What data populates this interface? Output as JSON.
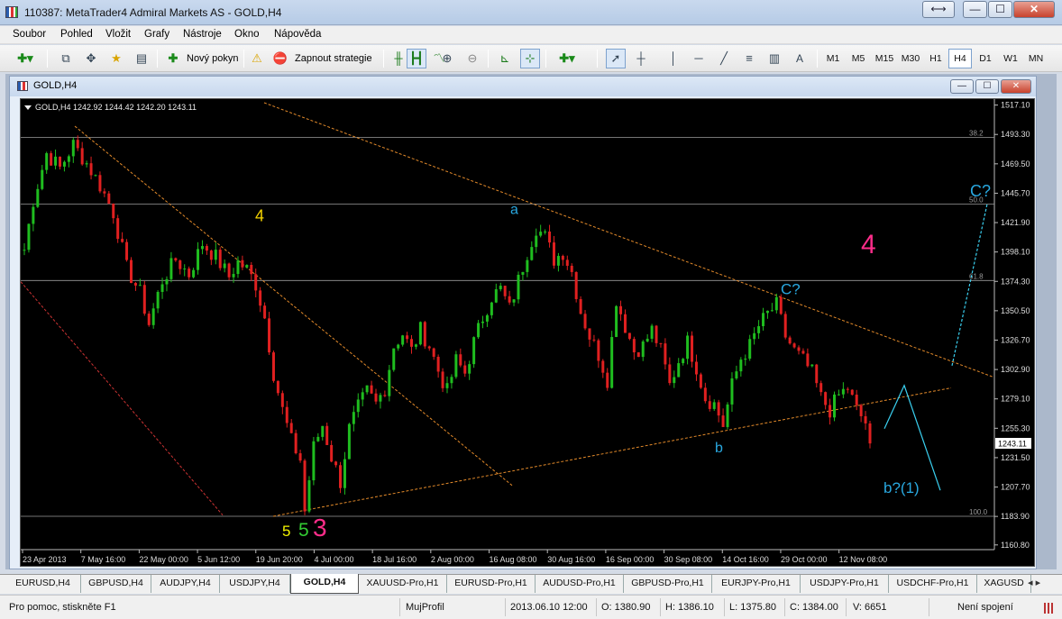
{
  "app": {
    "title": "110387: MetaTrader4 Admiral Markets AS - GOLD,H4"
  },
  "window_buttons": {
    "switch": "⟷",
    "minimize": "—",
    "maximize": "☐",
    "close": "✕"
  },
  "menu": [
    "Soubor",
    "Pohled",
    "Vložit",
    "Grafy",
    "Nástroje",
    "Okno",
    "Nápověda"
  ],
  "toolbar": {
    "new_order": "Nový pokyn",
    "auto_trading": "Zapnout strategie",
    "timeframes": [
      "M1",
      "M5",
      "M15",
      "M30",
      "H1",
      "H4",
      "D1",
      "W1",
      "MN"
    ],
    "active_timeframe": "H4",
    "text_tool": "A"
  },
  "chart_window": {
    "title": "GOLD,H4",
    "header": "GOLD,H4  1242.92 1244.42 1242.20 1243.11"
  },
  "chart_data": {
    "type": "candlestick",
    "symbol": "GOLD",
    "timeframe": "H4",
    "ohlc_last": {
      "open": 1242.92,
      "high": 1244.42,
      "low": 1242.2,
      "close": 1243.11
    },
    "current_price_label": "1243.11",
    "price_ticks": [
      1517.1,
      1493.3,
      1469.5,
      1445.7,
      1421.9,
      1398.1,
      1374.3,
      1350.5,
      1326.7,
      1302.9,
      1279.1,
      1255.3,
      1231.5,
      1207.7,
      1183.9,
      1160.8
    ],
    "price_tick_labels": [
      "1517.10",
      "1493.30",
      "1469.50",
      "1445.70",
      "1421.90",
      "1398.10",
      "1374.30",
      "1350.50",
      "1326.70",
      "1302.90",
      "1279.10",
      "1255.30",
      "1231.50",
      "1207.70",
      "1183.90",
      "1160.80"
    ],
    "ylim": [
      1157,
      1519
    ],
    "date_labels": [
      "23 Apr 2013",
      "7 May 16:00",
      "22 May 00:00",
      "5 Jun 12:00",
      "19 Jun 20:00",
      "4 Jul 00:00",
      "18 Jul 16:00",
      "2 Aug 00:00",
      "16 Aug 08:00",
      "30 Aug 16:00",
      "16 Sep 00:00",
      "30 Sep 08:00",
      "14 Oct 16:00",
      "29 Oct 00:00",
      "12 Nov 08:00"
    ],
    "close_path": [
      [
        0,
        1400
      ],
      [
        2,
        1440
      ],
      [
        5,
        1478
      ],
      [
        8,
        1466
      ],
      [
        11,
        1485
      ],
      [
        14,
        1470
      ],
      [
        17,
        1452
      ],
      [
        20,
        1430
      ],
      [
        23,
        1385
      ],
      [
        26,
        1365
      ],
      [
        28,
        1340
      ],
      [
        31,
        1375
      ],
      [
        34,
        1392
      ],
      [
        37,
        1380
      ],
      [
        40,
        1405
      ],
      [
        43,
        1394
      ],
      [
        46,
        1378
      ],
      [
        48,
        1390
      ],
      [
        50,
        1384
      ],
      [
        52,
        1372
      ],
      [
        54,
        1345
      ],
      [
        56,
        1300
      ],
      [
        58,
        1270
      ],
      [
        60,
        1245
      ],
      [
        62,
        1230
      ],
      [
        63,
        1188
      ],
      [
        65,
        1240
      ],
      [
        67,
        1258
      ],
      [
        69,
        1232
      ],
      [
        71,
        1212
      ],
      [
        73,
        1255
      ],
      [
        75,
        1272
      ],
      [
        77,
        1285
      ],
      [
        79,
        1275
      ],
      [
        81,
        1288
      ],
      [
        83,
        1322
      ],
      [
        85,
        1332
      ],
      [
        87,
        1318
      ],
      [
        89,
        1335
      ],
      [
        91,
        1322
      ],
      [
        93,
        1302
      ],
      [
        95,
        1285
      ],
      [
        97,
        1310
      ],
      [
        99,
        1300
      ],
      [
        101,
        1325
      ],
      [
        103,
        1345
      ],
      [
        105,
        1362
      ],
      [
        107,
        1368
      ],
      [
        109,
        1352
      ],
      [
        111,
        1375
      ],
      [
        113,
        1398
      ],
      [
        115,
        1418
      ],
      [
        117,
        1410
      ],
      [
        119,
        1392
      ],
      [
        121,
        1398
      ],
      [
        123,
        1382
      ],
      [
        125,
        1350
      ],
      [
        127,
        1330
      ],
      [
        129,
        1315
      ],
      [
        131,
        1295
      ],
      [
        133,
        1360
      ],
      [
        135,
        1338
      ],
      [
        137,
        1318
      ],
      [
        139,
        1322
      ],
      [
        141,
        1335
      ],
      [
        143,
        1318
      ],
      [
        145,
        1290
      ],
      [
        147,
        1310
      ],
      [
        149,
        1325
      ],
      [
        151,
        1305
      ],
      [
        153,
        1280
      ],
      [
        155,
        1275
      ],
      [
        157,
        1258
      ],
      [
        159,
        1290
      ],
      [
        161,
        1312
      ],
      [
        163,
        1322
      ],
      [
        165,
        1338
      ],
      [
        167,
        1348
      ],
      [
        169,
        1355
      ],
      [
        171,
        1330
      ],
      [
        173,
        1318
      ],
      [
        175,
        1310
      ],
      [
        177,
        1300
      ],
      [
        179,
        1280
      ],
      [
        181,
        1270
      ],
      [
        183,
        1282
      ],
      [
        185,
        1288
      ],
      [
        187,
        1270
      ],
      [
        189,
        1260
      ],
      [
        190,
        1243
      ]
    ],
    "x_count": 190,
    "annotations": [
      {
        "text": "4",
        "color": "#f5d300"
      },
      {
        "text": "a",
        "color": "#29a8e0"
      },
      {
        "text": "4",
        "color": "#ff2d8a"
      },
      {
        "text": "C?",
        "color": "#29a8e0"
      },
      {
        "text": "C?",
        "color": "#29a8e0"
      },
      {
        "text": "b",
        "color": "#29a8e0"
      },
      {
        "text": "b?(1)",
        "color": "#29a8e0"
      },
      {
        "text": "5",
        "color": "#f5f500"
      },
      {
        "text": "5",
        "color": "#33cc33"
      },
      {
        "text": "3",
        "color": "#ff2d8a"
      }
    ],
    "fibonacci": {
      "levels": [
        "38.2",
        "50.0",
        "61.8",
        "100.0"
      ],
      "prices": [
        1491,
        1437,
        1375,
        1184
      ]
    },
    "bull_color": "#1fbd1f",
    "bear_color": "#e02020"
  },
  "tabs": [
    "EURUSD,H4",
    "GBPUSD,H4",
    "AUDJPY,H4",
    "USDJPY,H4",
    "GOLD,H4",
    "XAUUSD-Pro,H1",
    "EURUSD-Pro,H1",
    "AUDUSD-Pro,H1",
    "GBPUSD-Pro,H1",
    "EURJPY-Pro,H1",
    "USDJPY-Pro,H1",
    "USDCHF-Pro,H1",
    "XAGUSD"
  ],
  "active_tab": "GOLD,H4",
  "status": {
    "help": "Pro pomoc, stiskněte F1",
    "profile": "MujProfil",
    "datetime": "2013.06.10 12:00",
    "open": "O: 1380.90",
    "high": "H: 1386.10",
    "low": "L: 1375.80",
    "close": "C: 1384.00",
    "volume": "V: 6651",
    "connection": "Není spojení"
  }
}
